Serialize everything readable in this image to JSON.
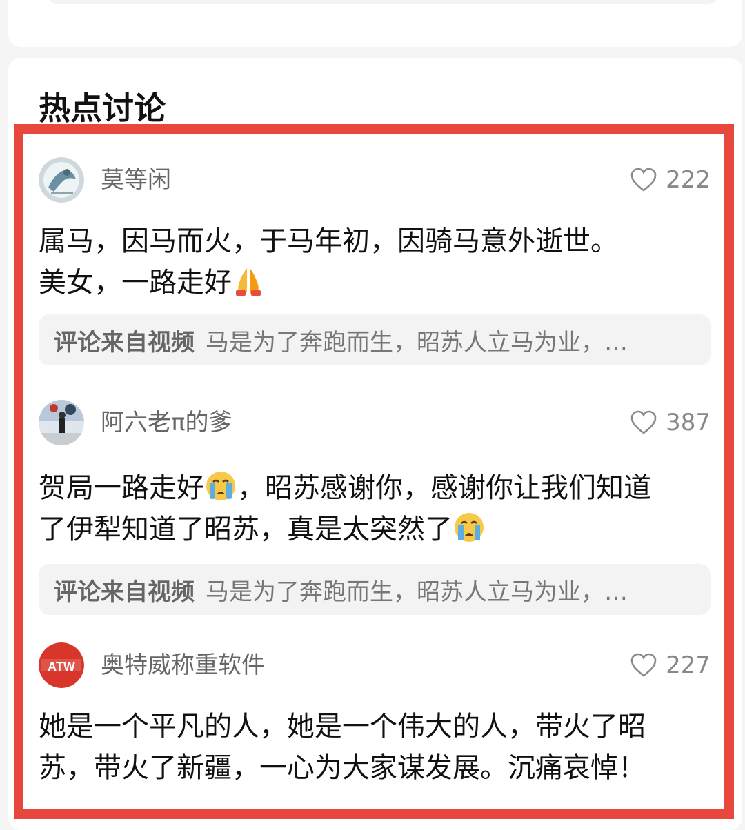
{
  "section": {
    "title": "热点讨论"
  },
  "comments": [
    {
      "username": "莫等闲",
      "likes": "222",
      "text_lines": [
        "属马，因马而火，于马年初，因骑马意外逝世。",
        "美女，一路走好"
      ],
      "emoji": "praying-hands",
      "source_label": "评论来自视频",
      "source_text": "马是为了奔跑而生，昭苏人立马为业，…"
    },
    {
      "username": "阿六老π的爹",
      "likes": "387",
      "text_parts": [
        "贺局一路走好",
        "，昭苏感谢你，感谢你让我们知道",
        "了伊犁知道了昭苏，真是太突然了"
      ],
      "emoji": "crying-face",
      "source_label": "评论来自视频",
      "source_text": "马是为了奔跑而生，昭苏人立马为业，…"
    },
    {
      "username": "奥特威称重软件",
      "likes": "227",
      "avatar_text": "ATW",
      "text_lines": [
        "她是一个平凡的人，她是一个伟大的人，带火了昭",
        "苏，带火了新疆，一心为大家谋发展。沉痛哀悼！"
      ]
    }
  ],
  "colors": {
    "highlight_border": "#e7473c",
    "card_background": "#ffffff",
    "page_background": "#f5f5f5",
    "source_background": "#f3f3f3"
  }
}
